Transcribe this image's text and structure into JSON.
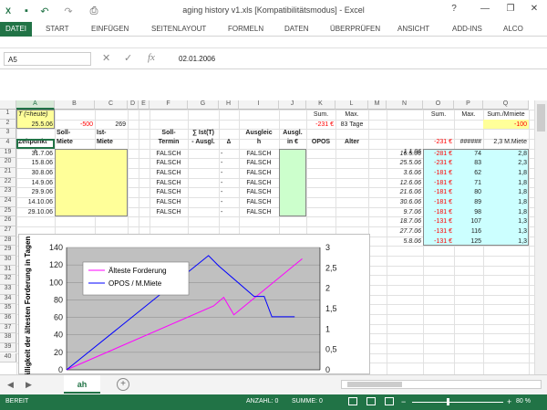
{
  "window": {
    "title": "aging history v1.xls  [Kompatibilitätsmodus] - Excel",
    "help": "?",
    "minimize": "—",
    "restore": "❐",
    "close": "✕"
  },
  "qat": {
    "save_icon": "save-icon",
    "undo_icon": "undo-icon",
    "redo_icon": "redo-icon",
    "preview_icon": "print-preview-icon"
  },
  "ribbon": {
    "tabs": [
      "DATEI",
      "START",
      "EINFÜGEN",
      "SEITENLAYOUT",
      "FORMELN",
      "DATEN",
      "ÜBERPRÜFEN",
      "ANSICHT",
      "ADD-INS",
      "ALCO"
    ],
    "active": "DATEI"
  },
  "formula_bar": {
    "name_box": "A5",
    "fx": "fx",
    "content": "02.01.2006"
  },
  "columns": [
    "A",
    "B",
    "C",
    "D",
    "E",
    "F",
    "G",
    "H",
    "I",
    "J",
    "K",
    "L",
    "M",
    "N",
    "O",
    "P",
    "Q"
  ],
  "rows": [
    "1",
    "2",
    "3",
    "4",
    "19",
    "20",
    "21",
    "22",
    "23",
    "24",
    "25",
    "26",
    "27",
    "28",
    "29",
    "30",
    "31",
    "32",
    "33",
    "34",
    "35",
    "36",
    "37",
    "38",
    "39",
    "40"
  ],
  "cells": {
    "a1": "T (=heute)",
    "a2": "25.5.06",
    "b2": "-500",
    "c2": "269",
    "k1": "Sum.",
    "l1": "Max.",
    "k2": "-231 €",
    "l2": "83 Tage",
    "o1": "Sum.",
    "p1": "Max.",
    "q1": "Sum./Mmiete",
    "q2": "-100",
    "b3": "Soll-",
    "b3b": "Miete",
    "c3": "Ist-",
    "c3b": "Miete",
    "a3": "Zeitpunkt",
    "a4": "t",
    "f3": "Soll-",
    "f3b": "Termin",
    "g3": "∑ Ist(T)",
    "g3b": "- Ausgl.",
    "h3": "∆",
    "i3": "Ausgleic",
    "i3b": "h",
    "j3": "Ausgl.",
    "j3b": "in €",
    "k3": "OPOS",
    "l3": "Alter",
    "o3": "-231 €",
    "p3": "######",
    "q3": "2,3 M.Miete",
    "n4": "1.1.06"
  },
  "table_a": [
    {
      "date": "31.7.06",
      "f": "FALSCH",
      "h": "-",
      "i": "FALSCH"
    },
    {
      "date": "15.8.06",
      "f": "FALSCH",
      "h": "-",
      "i": "FALSCH"
    },
    {
      "date": "30.8.06",
      "f": "FALSCH",
      "h": "-",
      "i": "FALSCH"
    },
    {
      "date": "14.9.06",
      "f": "FALSCH",
      "h": "-",
      "i": "FALSCH"
    },
    {
      "date": "29.9.06",
      "f": "FALSCH",
      "h": "-",
      "i": "FALSCH"
    },
    {
      "date": "14.10.06",
      "f": "FALSCH",
      "h": "-",
      "i": "FALSCH"
    },
    {
      "date": "29.10.06",
      "f": "FALSCH",
      "h": "-",
      "i": "FALSCH"
    }
  ],
  "table_n": [
    {
      "n": "16.5.06",
      "o": "-281 €",
      "p": "74",
      "q": "2,8"
    },
    {
      "n": "25.5.06",
      "o": "-231 €",
      "p": "83",
      "q": "2,3"
    },
    {
      "n": "3.6.06",
      "o": "-181 €",
      "p": "62",
      "q": "1,8"
    },
    {
      "n": "12.6.06",
      "o": "-181 €",
      "p": "71",
      "q": "1,8"
    },
    {
      "n": "21.6.06",
      "o": "-181 €",
      "p": "80",
      "q": "1,8"
    },
    {
      "n": "30.6.06",
      "o": "-181 €",
      "p": "89",
      "q": "1,8"
    },
    {
      "n": "9.7.06",
      "o": "-181 €",
      "p": "98",
      "q": "1,8"
    },
    {
      "n": "18.7.06",
      "o": "-131 €",
      "p": "107",
      "q": "1,3"
    },
    {
      "n": "27.7.06",
      "o": "-131 €",
      "p": "116",
      "q": "1,3"
    },
    {
      "n": "5.8.06",
      "o": "-131 €",
      "p": "125",
      "q": "1,3"
    }
  ],
  "sheet_tabs": {
    "active": "ah",
    "add": "+"
  },
  "status": {
    "ready": "BEREIT",
    "count": "ANZAHL: 0",
    "sum": "SUMME: 0",
    "zoom": "80 %"
  },
  "colors": {
    "accent": "#217346",
    "yellow": "#ffff99",
    "green": "#ccffcc",
    "cyan": "#ccffff",
    "pink": "#ff00ff",
    "blue": "#0000ff",
    "plotbg": "#c0c0c0"
  },
  "chart_data": {
    "type": "line",
    "title": "",
    "ylabel": "Fälligkeit der ältesten Forderung in Tagen",
    "ylim": [
      0,
      140
    ],
    "y2lim": [
      0,
      3
    ],
    "yticks": [
      "0",
      "20",
      "40",
      "60",
      "80",
      "100",
      "120",
      "140"
    ],
    "y2ticks": [
      "0",
      "0,5",
      "1",
      "1,5",
      "2",
      "2,5",
      "3"
    ],
    "x": [
      0,
      0.3,
      0.55,
      0.6,
      0.65,
      0.75,
      0.93
    ],
    "series": [
      {
        "name": "Älteste Forderung",
        "color": "#ff00ff",
        "axis": "left",
        "x": [
          0,
          0.58,
          0.62,
          0.66,
          0.93
        ],
        "values": [
          0,
          73,
          83,
          63,
          127
        ]
      },
      {
        "name": "OPOS / M.Miete",
        "color": "#0000ff",
        "axis": "right",
        "x": [
          0,
          0.56,
          0.6,
          0.74,
          0.78,
          0.81,
          0.9
        ],
        "values": [
          0,
          2.8,
          2.55,
          1.8,
          1.8,
          1.3,
          1.3
        ]
      }
    ],
    "grid": true,
    "legend": "top-left"
  }
}
